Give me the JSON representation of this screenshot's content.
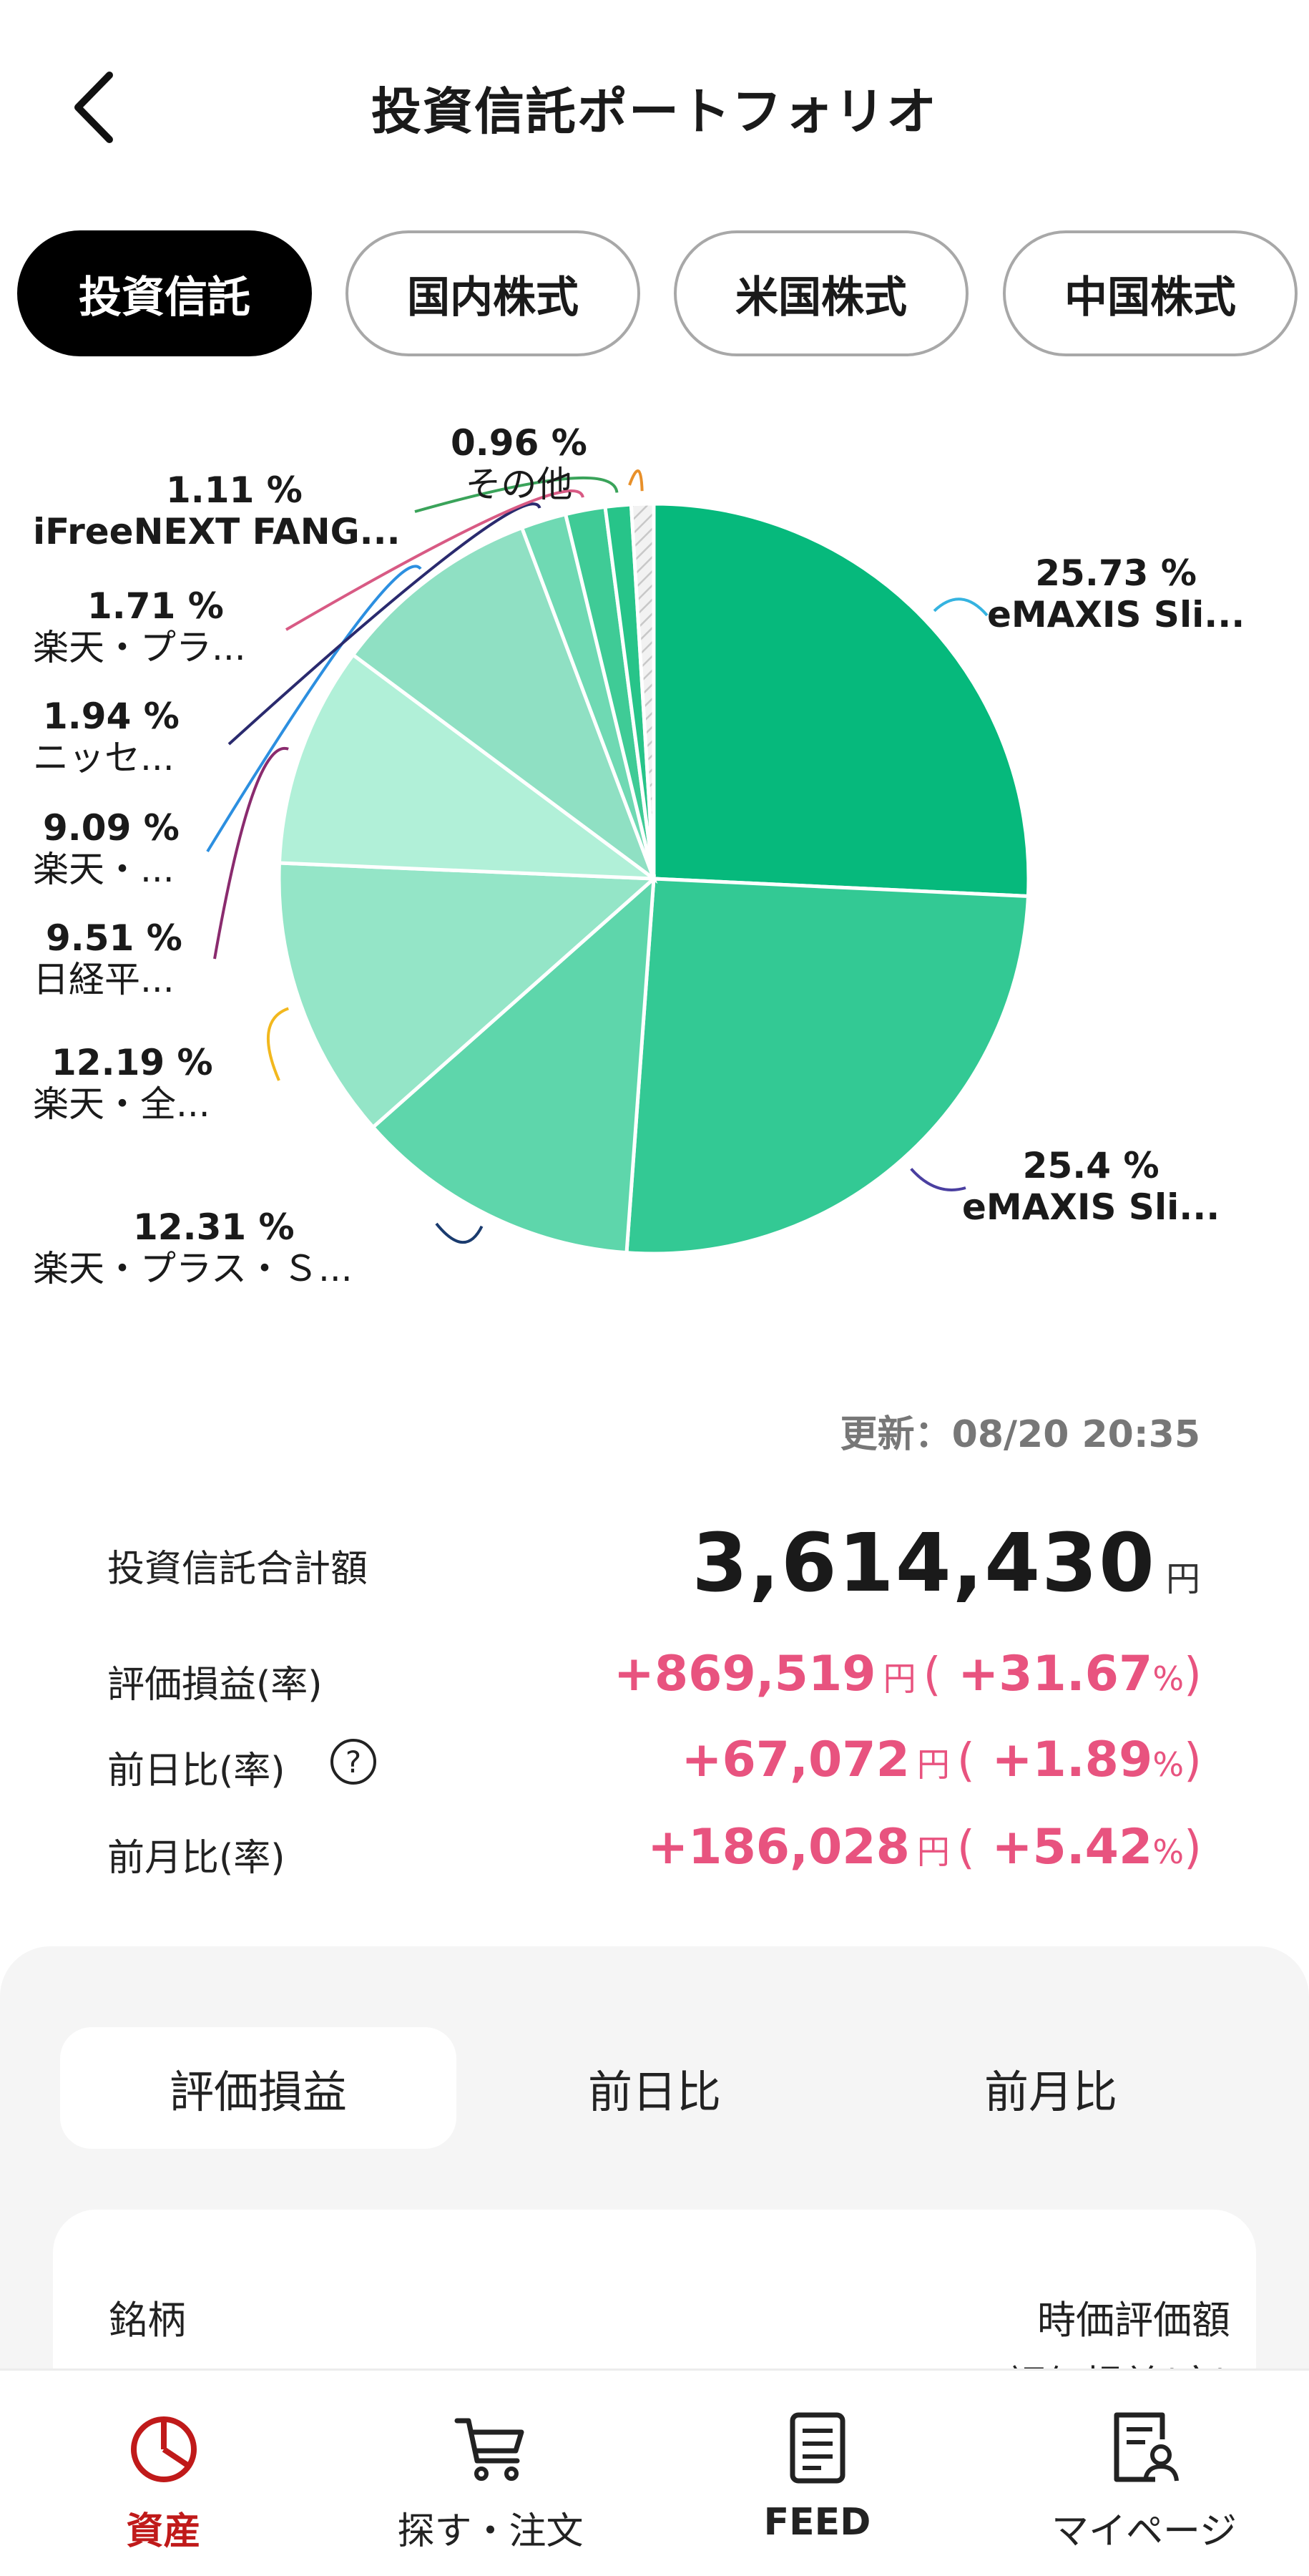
{
  "header": {
    "title": "投資信託ポートフォリオ"
  },
  "tabs": [
    {
      "label": "投資信託",
      "active": true
    },
    {
      "label": "国内株式",
      "active": false
    },
    {
      "label": "米国株式",
      "active": false
    },
    {
      "label": "中国株式",
      "active": false
    }
  ],
  "chart_data": {
    "type": "pie",
    "slices": [
      {
        "pct_label": "25.73 %",
        "name": "eMAXIS Sli...",
        "value": 25.73,
        "color": "#06b97c",
        "leader": "#35b3e0"
      },
      {
        "pct_label": "25.4 %",
        "name": "eMAXIS Sli...",
        "value": 25.4,
        "color": "#33c994",
        "leader": "#4a3fa0"
      },
      {
        "pct_label": "12.31 %",
        "name": "楽天・プラス・Ｓ...",
        "value": 12.31,
        "color": "#5ed6ab",
        "leader": "#1a3b6e"
      },
      {
        "pct_label": "12.19 %",
        "name": "楽天・全...",
        "value": 12.19,
        "color": "#94e5c7",
        "leader": "#f2b81e"
      },
      {
        "pct_label": "9.51 %",
        "name": "日経平...",
        "value": 9.51,
        "color": "#b1f0d8",
        "leader": "#8a2b6e"
      },
      {
        "pct_label": "9.09 %",
        "name": "楽天・...",
        "value": 9.09,
        "color": "#8fe0c3",
        "leader": "#2c8fe0"
      },
      {
        "pct_label": "1.94 %",
        "name": "ニッセ...",
        "value": 1.94,
        "color": "#6fd9b3",
        "leader": "#2a2a6e"
      },
      {
        "pct_label": "1.71 %",
        "name": "楽天・プラ...",
        "value": 1.71,
        "color": "#3fcb96",
        "leader": "#d85a84"
      },
      {
        "pct_label": "1.11 %",
        "name": "iFreeNEXT FANG...",
        "value": 1.11,
        "color": "#27c489",
        "leader": "#3aa35a"
      },
      {
        "pct_label": "0.96 %",
        "name": "その他",
        "value": 0.96,
        "color": "#e8e8e8",
        "leader": "#e8902a"
      }
    ]
  },
  "summary": {
    "updated_label": "更新：",
    "updated_value": "08/20 20:35",
    "total_label": "投資信託合計額",
    "total_value": "3,614,430",
    "yen": "円",
    "pnl_label": "評価損益(率)",
    "pnl_value": "+869,519",
    "pnl_rate": "+31.67",
    "day_label": "前日比(率)",
    "day_value": "+67,072",
    "day_rate": "+1.89",
    "month_label": "前月比(率)",
    "month_value": "+186,028",
    "month_rate": "+5.42",
    "percent": "%",
    "paren_open": "(",
    "paren_close": ")",
    "help": "?"
  },
  "segments": [
    {
      "label": "評価損益",
      "active": true
    },
    {
      "label": "前日比",
      "active": false
    },
    {
      "label": "前月比",
      "active": false
    }
  ],
  "table": {
    "col_name": "銘柄",
    "col_value": "時価評価額",
    "col_pnl": "評価損益(率)"
  },
  "nav": [
    {
      "label": "資産",
      "icon": "pie-chart-icon",
      "active": true,
      "color": "#c01a1a"
    },
    {
      "label": "探す・注文",
      "icon": "cart-icon",
      "active": false
    },
    {
      "label": "FEED",
      "icon": "newspaper-icon",
      "active": false
    },
    {
      "label": "マイページ",
      "icon": "user-document-icon",
      "active": false
    }
  ]
}
